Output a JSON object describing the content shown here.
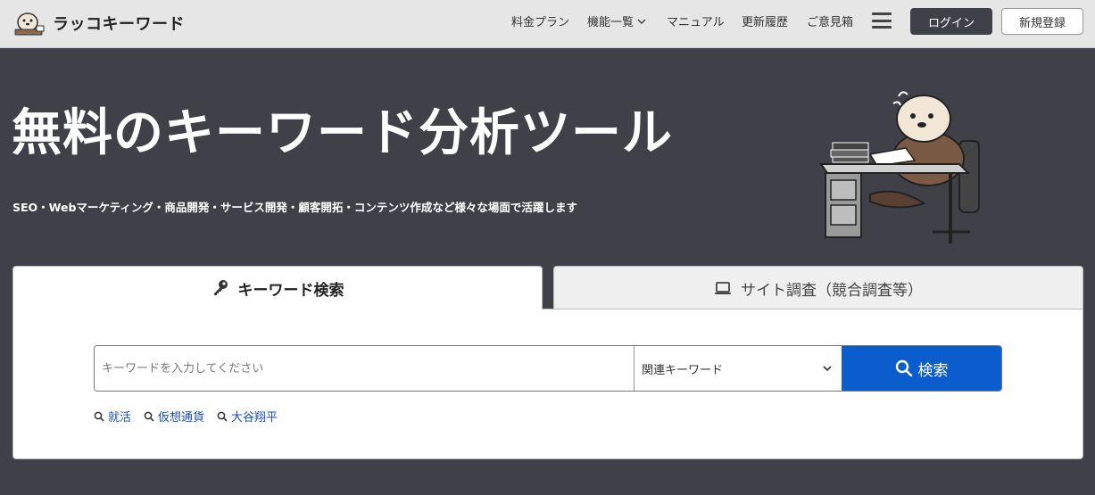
{
  "header": {
    "logo_text": "ラッコキーワード",
    "nav": [
      {
        "label": "料金プラン"
      },
      {
        "label": "機能一覧"
      },
      {
        "label": "マニュアル"
      },
      {
        "label": "更新履歴"
      },
      {
        "label": "ご意見箱"
      }
    ],
    "login_label": "ログイン",
    "register_label": "新規登録"
  },
  "hero": {
    "title": "無料のキーワード分析ツール",
    "subtitle": "SEO・Webマーケティング・商品開発・サービス開発・顧客開拓・コンテンツ作成など様々な場面で活躍します"
  },
  "tabs": [
    {
      "label": "キーワード検索",
      "icon": "key-icon",
      "active": true
    },
    {
      "label": "サイト調査（競合調査等）",
      "icon": "laptop-icon",
      "active": false
    }
  ],
  "search": {
    "placeholder": "キーワードを入力してください",
    "mode_selected": "関連キーワード",
    "button_label": "検索"
  },
  "suggestions": [
    {
      "label": "就活"
    },
    {
      "label": "仮想通貨"
    },
    {
      "label": "大谷翔平"
    }
  ],
  "colors": {
    "hero_bg": "#3f4048",
    "header_bg": "#e6e6e6",
    "accent_blue": "#0b5ccc",
    "link_blue": "#1a4fb8"
  }
}
